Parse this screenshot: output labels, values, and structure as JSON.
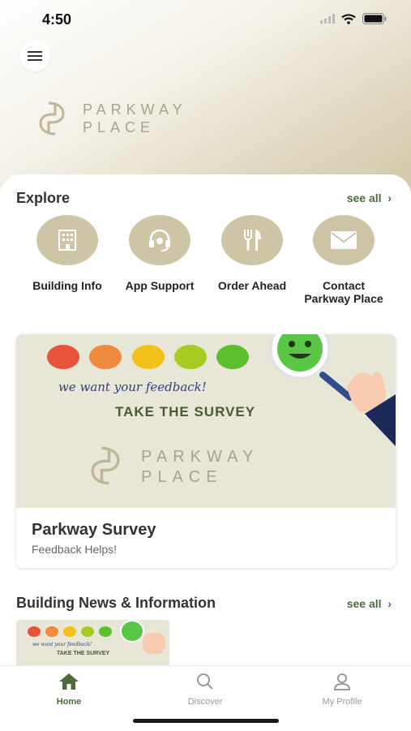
{
  "status": {
    "time": "4:50"
  },
  "brand": {
    "line1": "PARKWAY",
    "line2": "PLACE"
  },
  "explore": {
    "title": "Explore",
    "see_all": "see all",
    "items": [
      {
        "label": "Building Info",
        "icon": "building-icon"
      },
      {
        "label": "App Support",
        "icon": "headset-icon"
      },
      {
        "label": "Order Ahead",
        "icon": "utensils-icon"
      },
      {
        "label": "Contact\nParkway Place",
        "icon": "envelope-icon"
      }
    ]
  },
  "survey": {
    "banner_tagline": "we want your feedback!",
    "banner_cta": "TAKE THE SURVEY",
    "banner_brand1": "PARKWAY",
    "banner_brand2": "PLACE",
    "title": "Parkway Survey",
    "subtitle": "Feedback Helps!"
  },
  "news": {
    "title": "Building News & Information",
    "see_all": "see all",
    "thumb_tagline": "we want your feedback!",
    "thumb_cta": "TAKE THE SURVEY"
  },
  "tabs": [
    {
      "label": "Home",
      "active": true
    },
    {
      "label": "Discover",
      "active": false
    },
    {
      "label": "My Profile",
      "active": false
    }
  ],
  "colors": {
    "accent_green": "#4e6b3d",
    "tan": "#cdc5a6"
  }
}
